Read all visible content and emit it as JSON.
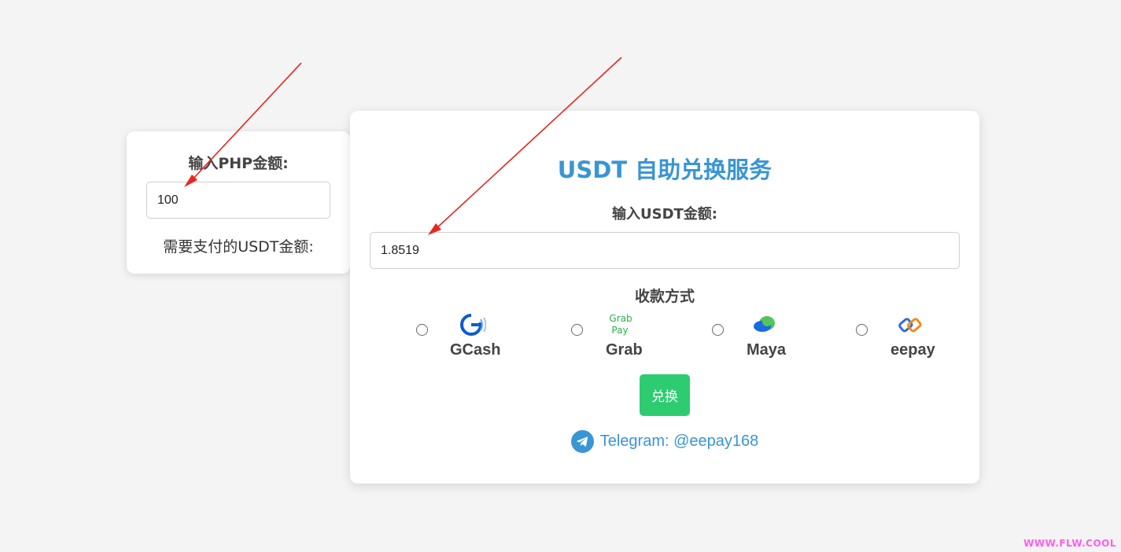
{
  "php_card": {
    "label": "输入PHP金额:",
    "input_value": "100",
    "result_label": "需要支付的USDT金额:"
  },
  "main_card": {
    "title": "USDT 自助兑换服务",
    "usdt_label": "输入USDT金额:",
    "usdt_value": "1.8519",
    "payment_label": "收款方式",
    "payment_methods": [
      {
        "name": "GCash",
        "icon": "gcash-logo-icon"
      },
      {
        "name": "Grab",
        "icon": "grabpay-logo-icon"
      },
      {
        "name": "Maya",
        "icon": "maya-logo-icon"
      },
      {
        "name": "eepay",
        "icon": "eepay-logo-icon"
      }
    ],
    "exchange_button": "兑换",
    "telegram_text": "Telegram:  @eepay168"
  },
  "annotations": {
    "arrow_color": "#e8261e",
    "icon": "red-arrow-annotation"
  },
  "watermark": "WWW.FLW.COOL",
  "colors": {
    "title": "#3a95d4",
    "button": "#2ecc71",
    "background": "#f4f4f4"
  }
}
